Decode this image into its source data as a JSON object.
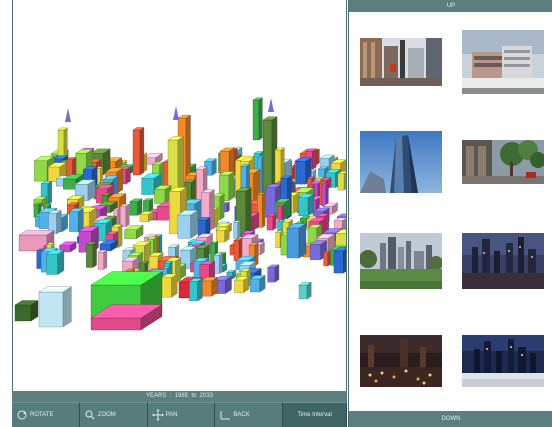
{
  "viewport": {
    "years_label": "YEARS  :  1985  to  2033"
  },
  "toolbar": {
    "rotate_label": "ROTATE",
    "zoom_label": "ZOOM",
    "pan_label": "PAN",
    "back_label": "BACK",
    "time_interval_label": "Time Interval"
  },
  "gallery": {
    "up_label": "UP",
    "down_label": "DOWN",
    "thumbnails": [
      {
        "name": "street-towers-photo"
      },
      {
        "name": "modern-building-photo"
      },
      {
        "name": "tall-tower-sky-photo"
      },
      {
        "name": "tree-lined-street-photo"
      },
      {
        "name": "skyline-park-photo"
      },
      {
        "name": "skyline-dusk-photo"
      },
      {
        "name": "city-night-lights-photo"
      },
      {
        "name": "skyline-night-photo"
      }
    ]
  },
  "colors": {
    "panel_teal": "#5b7f7f",
    "toolbar_teal": "#4e7474",
    "active_tool": "#3f6464"
  }
}
